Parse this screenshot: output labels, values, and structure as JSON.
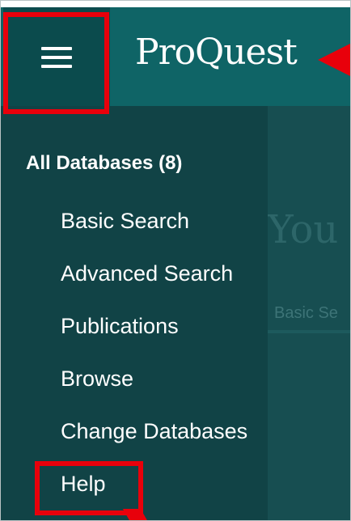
{
  "header": {
    "logo_text": "ProQuest",
    "menu_icon": "hamburger-icon"
  },
  "side_menu": {
    "heading": "All Databases (8)",
    "items": [
      {
        "label": "Basic Search"
      },
      {
        "label": "Advanced Search"
      },
      {
        "label": "Publications"
      },
      {
        "label": "Browse"
      },
      {
        "label": "Change Databases"
      },
      {
        "label": "Help"
      }
    ]
  },
  "background_page": {
    "title_fragment": "You",
    "tab_fragment": "Basic Se"
  },
  "colors": {
    "header_bg": "#0f6466",
    "menu_button_bg": "#0b4b4d",
    "side_menu_bg": "#114346",
    "highlight": "#e8000b",
    "text": "#ffffff"
  }
}
